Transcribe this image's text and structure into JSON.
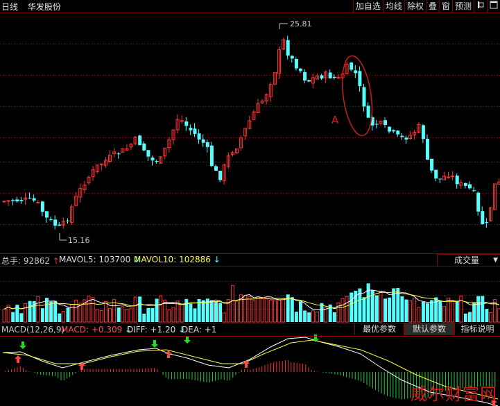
{
  "header": {
    "period": "日线",
    "stock_name": "华发股份",
    "buttons": [
      "加自选",
      "均线",
      "除权",
      "叠",
      "窗",
      "预测"
    ],
    "pin_icon": "pin-icon",
    "expand_icon": "expand-icon"
  },
  "price_chart": {
    "high_label": "25.81",
    "low_label": "15.16",
    "annotation": "A"
  },
  "volume": {
    "total_label": "总手: ",
    "total_value": "92862",
    "mavol5_label": "MAVOL5: ",
    "mavol5_value": "103700",
    "mavol10_label": "MAVOL10: ",
    "mavol10_value": "102886",
    "selector": "成交量"
  },
  "macd": {
    "name": "MACD(12,26,9)",
    "macd_label": "MACD: ",
    "macd_value": "+0.309",
    "diff_label": "DIFF: ",
    "diff_value": "+1.20",
    "dea_label": "DEA: ",
    "dea_value": "+1",
    "tabs": [
      "最优参数",
      "默认参数",
      "指标说明"
    ],
    "active_tab": "默认参数"
  },
  "watermark": "威尔财富网",
  "colors": {
    "up": "#ff3232",
    "down": "#54ffff",
    "grid": "#7a0000",
    "text": "#c8c8c8",
    "ma5": "#ffffff",
    "ma10": "#ffff44"
  }
}
